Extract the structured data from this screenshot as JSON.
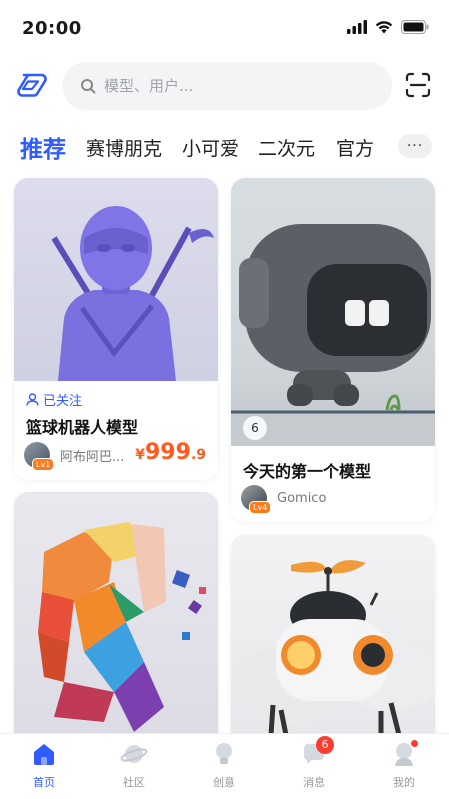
{
  "status": {
    "time": "20:00"
  },
  "search": {
    "placeholder": "模型、用户..."
  },
  "tabs": [
    {
      "label": "推荐",
      "active": true
    },
    {
      "label": "赛博朋克"
    },
    {
      "label": "小可爱"
    },
    {
      "label": "二次元"
    },
    {
      "label": "官方"
    }
  ],
  "more_label": "···",
  "cards": [
    {
      "image": "purple-ninja-figure",
      "followed_label": "已关注",
      "title": "篮球机器人模型",
      "author": "阿布阿巴...",
      "level": "Lv1",
      "price_currency": "¥",
      "price_int": "999",
      "price_dec": ".9"
    },
    {
      "image": "gray-robot-head",
      "count": "6",
      "title": "今天的第一个模型",
      "author": "Gomico",
      "level": "Lv4"
    },
    {
      "image": "colorful-block-head"
    },
    {
      "image": "propeller-robot"
    }
  ],
  "nav": [
    {
      "label": "首页",
      "icon": "home-icon",
      "active": true
    },
    {
      "label": "社区",
      "icon": "planet-icon"
    },
    {
      "label": "创意",
      "icon": "lightbulb-icon"
    },
    {
      "label": "消息",
      "icon": "message-icon",
      "badge": "6"
    },
    {
      "label": "我的",
      "icon": "profile-icon",
      "dot": true
    }
  ],
  "colors": {
    "accent": "#2f5bff",
    "price": "#ff5a1f",
    "badge": "#ff3b30"
  }
}
